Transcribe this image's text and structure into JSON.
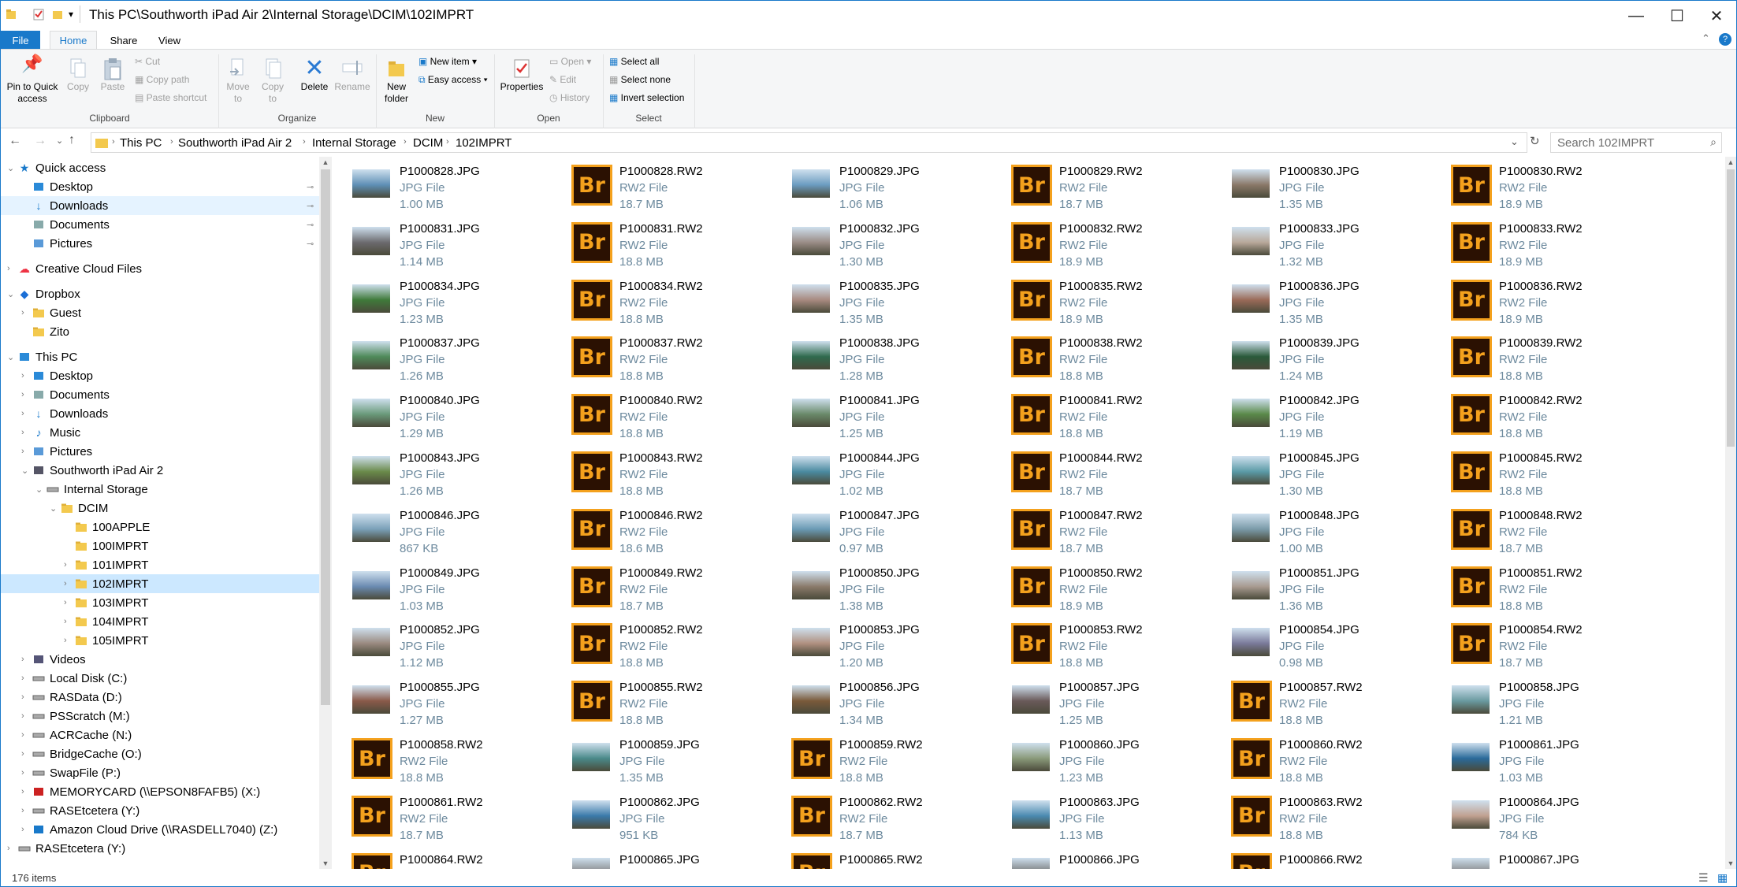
{
  "window": {
    "title": "This PC\\Southworth iPad Air 2\\Internal Storage\\DCIM\\102IMPRT"
  },
  "tabs": {
    "file": "File",
    "home": "Home",
    "share": "Share",
    "view": "View"
  },
  "ribbon": {
    "clipboard": {
      "label": "Clipboard",
      "pin": "Pin to Quick access",
      "copy": "Copy",
      "paste": "Paste",
      "cut": "Cut",
      "copy_path": "Copy path",
      "paste_shortcut": "Paste shortcut"
    },
    "organize": {
      "label": "Organize",
      "move_to": "Move to",
      "copy_to": "Copy to",
      "delete": "Delete",
      "rename": "Rename"
    },
    "new": {
      "label": "New",
      "new_folder": "New folder",
      "new_item": "New item",
      "easy_access": "Easy access"
    },
    "open": {
      "label": "Open",
      "properties": "Properties",
      "open": "Open",
      "edit": "Edit",
      "history": "History"
    },
    "select": {
      "label": "Select",
      "select_all": "Select all",
      "select_none": "Select none",
      "invert": "Invert selection"
    }
  },
  "address": {
    "crumbs": [
      "This PC",
      "Southworth iPad Air 2",
      "Internal Storage",
      "DCIM",
      "102IMPRT"
    ],
    "search_placeholder": "Search 102IMPRT"
  },
  "sidebar": {
    "items": [
      {
        "label": "Quick access",
        "level": 0,
        "state": "expanded",
        "icon": "star-icon"
      },
      {
        "label": "Desktop",
        "level": 1,
        "icon": "desktop-icon",
        "pinned": true
      },
      {
        "label": "Downloads",
        "level": 1,
        "icon": "download-icon",
        "pinned": true,
        "hover": true
      },
      {
        "label": "Documents",
        "level": 1,
        "icon": "document-icon",
        "pinned": true
      },
      {
        "label": "Pictures",
        "level": 1,
        "icon": "pictures-icon",
        "pinned": true
      },
      {
        "label": "Creative Cloud Files",
        "level": 0,
        "state": "collapsed",
        "icon": "creative-cloud-icon"
      },
      {
        "label": "Dropbox",
        "level": 0,
        "state": "expanded",
        "icon": "dropbox-icon"
      },
      {
        "label": "Guest",
        "level": 1,
        "state": "collapsed",
        "icon": "folder-icon"
      },
      {
        "label": "Zito",
        "level": 1,
        "icon": "folder-icon"
      },
      {
        "label": "This PC",
        "level": 0,
        "state": "expanded",
        "icon": "computer-icon"
      },
      {
        "label": "Desktop",
        "level": 1,
        "state": "collapsed",
        "icon": "desktop-icon"
      },
      {
        "label": "Documents",
        "level": 1,
        "state": "collapsed",
        "icon": "document-icon"
      },
      {
        "label": "Downloads",
        "level": 1,
        "state": "collapsed",
        "icon": "download-icon"
      },
      {
        "label": "Music",
        "level": 1,
        "state": "collapsed",
        "icon": "music-icon"
      },
      {
        "label": "Pictures",
        "level": 1,
        "state": "collapsed",
        "icon": "pictures-icon"
      },
      {
        "label": "Southworth iPad Air 2",
        "level": 1,
        "state": "expanded",
        "icon": "tablet-icon"
      },
      {
        "label": "Internal Storage",
        "level": 2,
        "state": "expanded",
        "icon": "drive-icon"
      },
      {
        "label": "DCIM",
        "level": 3,
        "state": "expanded",
        "icon": "folder-icon"
      },
      {
        "label": "100APPLE",
        "level": 4,
        "icon": "folder-icon"
      },
      {
        "label": "100IMPRT",
        "level": 4,
        "icon": "folder-icon"
      },
      {
        "label": "101IMPRT",
        "level": 4,
        "state": "collapsed",
        "icon": "folder-icon"
      },
      {
        "label": "102IMPRT",
        "level": 4,
        "state": "collapsed",
        "icon": "folder-icon",
        "selected": true
      },
      {
        "label": "103IMPRT",
        "level": 4,
        "state": "collapsed",
        "icon": "folder-icon"
      },
      {
        "label": "104IMPRT",
        "level": 4,
        "state": "collapsed",
        "icon": "folder-icon"
      },
      {
        "label": "105IMPRT",
        "level": 4,
        "state": "collapsed",
        "icon": "folder-icon"
      },
      {
        "label": "Videos",
        "level": 1,
        "state": "collapsed",
        "icon": "videos-icon"
      },
      {
        "label": "Local Disk (C:)",
        "level": 1,
        "state": "collapsed",
        "icon": "drive-icon"
      },
      {
        "label": "RASData (D:)",
        "level": 1,
        "state": "collapsed",
        "icon": "drive-icon"
      },
      {
        "label": "PSScratch (M:)",
        "level": 1,
        "state": "collapsed",
        "icon": "drive-icon"
      },
      {
        "label": "ACRCache (N:)",
        "level": 1,
        "state": "collapsed",
        "icon": "drive-icon"
      },
      {
        "label": "BridgeCache (O:)",
        "level": 1,
        "state": "collapsed",
        "icon": "drive-icon"
      },
      {
        "label": "SwapFile (P:)",
        "level": 1,
        "state": "collapsed",
        "icon": "drive-icon"
      },
      {
        "label": "MEMORYCARD (\\\\EPSON8FAFB5) (X:)",
        "level": 1,
        "state": "collapsed",
        "icon": "network-drive-disconnected-icon"
      },
      {
        "label": "RASEtcetera (Y:)",
        "level": 1,
        "state": "collapsed",
        "icon": "drive-icon"
      },
      {
        "label": "Amazon Cloud Drive (\\\\RASDELL7040) (Z:)",
        "level": 1,
        "state": "collapsed",
        "icon": "network-drive-icon"
      },
      {
        "label": "RASEtcetera (Y:)",
        "level": 0,
        "state": "collapsed",
        "icon": "drive-icon"
      }
    ]
  },
  "files": [
    {
      "name": "P1000828.JPG",
      "type": "JPG File",
      "size": "1.00 MB",
      "kind": "jpg",
      "color": "#5e8fb5"
    },
    {
      "name": "P1000828.RW2",
      "type": "RW2 File",
      "size": "18.7 MB",
      "kind": "rw2"
    },
    {
      "name": "P1000829.JPG",
      "type": "JPG File",
      "size": "1.06 MB",
      "kind": "jpg",
      "color": "#6b9cc0"
    },
    {
      "name": "P1000829.RW2",
      "type": "RW2 File",
      "size": "18.7 MB",
      "kind": "rw2"
    },
    {
      "name": "P1000830.JPG",
      "type": "JPG File",
      "size": "1.35 MB",
      "kind": "jpg",
      "color": "#8a7868"
    },
    {
      "name": "P1000830.RW2",
      "type": "RW2 File",
      "size": "18.9 MB",
      "kind": "rw2"
    },
    {
      "name": "P1000831.JPG",
      "type": "JPG File",
      "size": "1.14 MB",
      "kind": "jpg",
      "color": "#6c6a6e"
    },
    {
      "name": "P1000831.RW2",
      "type": "RW2 File",
      "size": "18.8 MB",
      "kind": "rw2"
    },
    {
      "name": "P1000832.JPG",
      "type": "JPG File",
      "size": "1.30 MB",
      "kind": "jpg",
      "color": "#9a8c86"
    },
    {
      "name": "P1000832.RW2",
      "type": "RW2 File",
      "size": "18.9 MB",
      "kind": "rw2"
    },
    {
      "name": "P1000833.JPG",
      "type": "JPG File",
      "size": "1.32 MB",
      "kind": "jpg",
      "color": "#b8a89a"
    },
    {
      "name": "P1000833.RW2",
      "type": "RW2 File",
      "size": "18.9 MB",
      "kind": "rw2"
    },
    {
      "name": "P1000834.JPG",
      "type": "JPG File",
      "size": "1.23 MB",
      "kind": "jpg",
      "color": "#3f7a3a"
    },
    {
      "name": "P1000834.RW2",
      "type": "RW2 File",
      "size": "18.8 MB",
      "kind": "rw2"
    },
    {
      "name": "P1000835.JPG",
      "type": "JPG File",
      "size": "1.35 MB",
      "kind": "jpg",
      "color": "#a88a80"
    },
    {
      "name": "P1000835.RW2",
      "type": "RW2 File",
      "size": "18.9 MB",
      "kind": "rw2"
    },
    {
      "name": "P1000836.JPG",
      "type": "JPG File",
      "size": "1.35 MB",
      "kind": "jpg",
      "color": "#9a6a58"
    },
    {
      "name": "P1000836.RW2",
      "type": "RW2 File",
      "size": "18.9 MB",
      "kind": "rw2"
    },
    {
      "name": "P1000837.JPG",
      "type": "JPG File",
      "size": "1.26 MB",
      "kind": "jpg",
      "color": "#4f8a5a"
    },
    {
      "name": "P1000837.RW2",
      "type": "RW2 File",
      "size": "18.8 MB",
      "kind": "rw2"
    },
    {
      "name": "P1000838.JPG",
      "type": "JPG File",
      "size": "1.28 MB",
      "kind": "jpg",
      "color": "#2f6a4e"
    },
    {
      "name": "P1000838.RW2",
      "type": "RW2 File",
      "size": "18.8 MB",
      "kind": "rw2"
    },
    {
      "name": "P1000839.JPG",
      "type": "JPG File",
      "size": "1.24 MB",
      "kind": "jpg",
      "color": "#2a5a3a"
    },
    {
      "name": "P1000839.RW2",
      "type": "RW2 File",
      "size": "18.8 MB",
      "kind": "rw2"
    },
    {
      "name": "P1000840.JPG",
      "type": "JPG File",
      "size": "1.29 MB",
      "kind": "jpg",
      "color": "#6a9a7a"
    },
    {
      "name": "P1000840.RW2",
      "type": "RW2 File",
      "size": "18.8 MB",
      "kind": "rw2"
    },
    {
      "name": "P1000841.JPG",
      "type": "JPG File",
      "size": "1.25 MB",
      "kind": "jpg",
      "color": "#6a8a6a"
    },
    {
      "name": "P1000841.RW2",
      "type": "RW2 File",
      "size": "18.8 MB",
      "kind": "rw2"
    },
    {
      "name": "P1000842.JPG",
      "type": "JPG File",
      "size": "1.19 MB",
      "kind": "jpg",
      "color": "#5a8a4a"
    },
    {
      "name": "P1000842.RW2",
      "type": "RW2 File",
      "size": "18.8 MB",
      "kind": "rw2"
    },
    {
      "name": "P1000843.JPG",
      "type": "JPG File",
      "size": "1.26 MB",
      "kind": "jpg",
      "color": "#6a8a4a"
    },
    {
      "name": "P1000843.RW2",
      "type": "RW2 File",
      "size": "18.8 MB",
      "kind": "rw2"
    },
    {
      "name": "P1000844.JPG",
      "type": "JPG File",
      "size": "1.02 MB",
      "kind": "jpg",
      "color": "#4a8aa0"
    },
    {
      "name": "P1000844.RW2",
      "type": "RW2 File",
      "size": "18.7 MB",
      "kind": "rw2"
    },
    {
      "name": "P1000845.JPG",
      "type": "JPG File",
      "size": "1.30 MB",
      "kind": "jpg",
      "color": "#5a9aa6"
    },
    {
      "name": "P1000845.RW2",
      "type": "RW2 File",
      "size": "18.8 MB",
      "kind": "rw2"
    },
    {
      "name": "P1000846.JPG",
      "type": "JPG File",
      "size": "867 KB",
      "kind": "jpg",
      "color": "#7aa0b8"
    },
    {
      "name": "P1000846.RW2",
      "type": "RW2 File",
      "size": "18.6 MB",
      "kind": "rw2"
    },
    {
      "name": "P1000847.JPG",
      "type": "JPG File",
      "size": "0.97 MB",
      "kind": "jpg",
      "color": "#6a9ab4"
    },
    {
      "name": "P1000847.RW2",
      "type": "RW2 File",
      "size": "18.7 MB",
      "kind": "rw2"
    },
    {
      "name": "P1000848.JPG",
      "type": "JPG File",
      "size": "1.00 MB",
      "kind": "jpg",
      "color": "#7a9aa8"
    },
    {
      "name": "P1000848.RW2",
      "type": "RW2 File",
      "size": "18.7 MB",
      "kind": "rw2"
    },
    {
      "name": "P1000849.JPG",
      "type": "JPG File",
      "size": "1.03 MB",
      "kind": "jpg",
      "color": "#6a8ab0"
    },
    {
      "name": "P1000849.RW2",
      "type": "RW2 File",
      "size": "18.7 MB",
      "kind": "rw2"
    },
    {
      "name": "P1000850.JPG",
      "type": "JPG File",
      "size": "1.38 MB",
      "kind": "jpg",
      "color": "#8a7a6a"
    },
    {
      "name": "P1000850.RW2",
      "type": "RW2 File",
      "size": "18.9 MB",
      "kind": "rw2"
    },
    {
      "name": "P1000851.JPG",
      "type": "JPG File",
      "size": "1.36 MB",
      "kind": "jpg",
      "color": "#a89a90"
    },
    {
      "name": "P1000851.RW2",
      "type": "RW2 File",
      "size": "18.8 MB",
      "kind": "rw2"
    },
    {
      "name": "P1000852.JPG",
      "type": "JPG File",
      "size": "1.12 MB",
      "kind": "jpg",
      "color": "#9a8a80"
    },
    {
      "name": "P1000852.RW2",
      "type": "RW2 File",
      "size": "18.8 MB",
      "kind": "rw2"
    },
    {
      "name": "P1000853.JPG",
      "type": "JPG File",
      "size": "1.20 MB",
      "kind": "jpg",
      "color": "#b09080"
    },
    {
      "name": "P1000853.RW2",
      "type": "RW2 File",
      "size": "18.8 MB",
      "kind": "rw2"
    },
    {
      "name": "P1000854.JPG",
      "type": "JPG File",
      "size": "0.98 MB",
      "kind": "jpg",
      "color": "#7a7a9a"
    },
    {
      "name": "P1000854.RW2",
      "type": "RW2 File",
      "size": "18.7 MB",
      "kind": "rw2"
    },
    {
      "name": "P1000855.JPG",
      "type": "JPG File",
      "size": "1.27 MB",
      "kind": "jpg",
      "color": "#8a5a4a"
    },
    {
      "name": "P1000855.RW2",
      "type": "RW2 File",
      "size": "18.8 MB",
      "kind": "rw2"
    },
    {
      "name": "P1000856.JPG",
      "type": "JPG File",
      "size": "1.34 MB",
      "kind": "jpg",
      "color": "#7a5a3a"
    },
    {
      "name": "P1000857.JPG",
      "type": "JPG File",
      "size": "1.25 MB",
      "kind": "jpg",
      "color": "#6a5a5a"
    },
    {
      "name": "P1000857.RW2",
      "type": "RW2 File",
      "size": "18.8 MB",
      "kind": "rw2"
    },
    {
      "name": "P1000858.JPG",
      "type": "JPG File",
      "size": "1.21 MB",
      "kind": "jpg",
      "color": "#6a9aa0"
    },
    {
      "name": "P1000858.RW2",
      "type": "RW2 File",
      "size": "18.8 MB",
      "kind": "rw2"
    },
    {
      "name": "P1000859.JPG",
      "type": "JPG File",
      "size": "1.35 MB",
      "kind": "jpg",
      "color": "#4a8a8a"
    },
    {
      "name": "P1000859.RW2",
      "type": "RW2 File",
      "size": "18.8 MB",
      "kind": "rw2"
    },
    {
      "name": "P1000860.JPG",
      "type": "JPG File",
      "size": "1.23 MB",
      "kind": "jpg",
      "color": "#8a9a7a"
    },
    {
      "name": "P1000860.RW2",
      "type": "RW2 File",
      "size": "18.8 MB",
      "kind": "rw2"
    },
    {
      "name": "P1000861.JPG",
      "type": "JPG File",
      "size": "1.03 MB",
      "kind": "jpg",
      "color": "#2a6a9a"
    },
    {
      "name": "P1000861.RW2",
      "type": "RW2 File",
      "size": "18.7 MB",
      "kind": "rw2"
    },
    {
      "name": "P1000862.JPG",
      "type": "JPG File",
      "size": "951 KB",
      "kind": "jpg",
      "color": "#3a7aaa"
    },
    {
      "name": "P1000862.RW2",
      "type": "RW2 File",
      "size": "18.7 MB",
      "kind": "rw2"
    },
    {
      "name": "P1000863.JPG",
      "type": "JPG File",
      "size": "1.13 MB",
      "kind": "jpg",
      "color": "#4a8ab0"
    },
    {
      "name": "P1000863.RW2",
      "type": "RW2 File",
      "size": "18.8 MB",
      "kind": "rw2"
    },
    {
      "name": "P1000864.JPG",
      "type": "JPG File",
      "size": "784 KB",
      "kind": "jpg",
      "color": "#c0a090"
    },
    {
      "name": "P1000864.RW2",
      "type": "",
      "size": "",
      "kind": "rw2"
    },
    {
      "name": "P1000865.JPG",
      "type": "",
      "size": "",
      "kind": "jpg",
      "color": "#808080"
    },
    {
      "name": "P1000865.RW2",
      "type": "",
      "size": "",
      "kind": "rw2"
    },
    {
      "name": "P1000866.JPG",
      "type": "",
      "size": "",
      "kind": "jpg",
      "color": "#707070"
    },
    {
      "name": "P1000866.RW2",
      "type": "",
      "size": "",
      "kind": "rw2"
    },
    {
      "name": "P1000867.JPG",
      "type": "",
      "size": "",
      "kind": "jpg",
      "color": "#808080"
    }
  ],
  "bridge_icon_text": "Br",
  "status": {
    "count": "176 items"
  },
  "colors": {
    "accent": "#1979ca",
    "selection": "#cce8ff",
    "bridge_bg": "#2b1102",
    "bridge_fg": "#f4a11d"
  }
}
